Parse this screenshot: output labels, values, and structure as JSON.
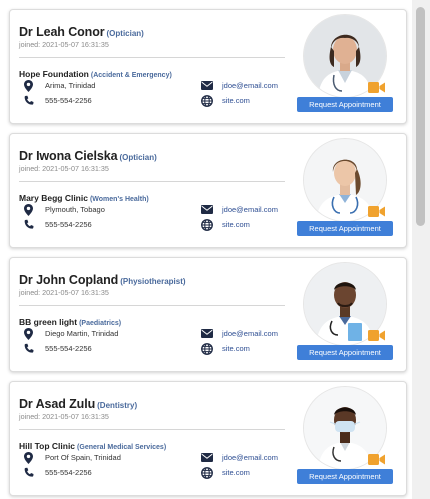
{
  "colors": {
    "accent": "#3f7fd8",
    "specialty_text": "#4a6a9c",
    "link": "#2f4f93",
    "video_icon": "#f0a22e"
  },
  "icons": {
    "location": "map-marker-icon",
    "phone": "phone-icon",
    "email": "envelope-icon",
    "website": "globe-icon",
    "video": "video-camera-icon"
  },
  "doctors": [
    {
      "name": "Dr Leah Conor",
      "specialty": "(Optician)",
      "joined": "joined: 2021-05-07 16:31:35",
      "facility": "Hope Foundation",
      "facility_type": "(Accident & Emergency)",
      "location": "Arima, Trinidad",
      "phone": "555-554-2256",
      "email": "jdoe@email.com",
      "website": "site.com",
      "button": "Request Appointment"
    },
    {
      "name": "Dr Iwona Cielska",
      "specialty": "(Optician)",
      "joined": "joined: 2021-05-07 16:31:35",
      "facility": "Mary Begg Clinic",
      "facility_type": "(Women's Health)",
      "location": "Plymouth, Tobago",
      "phone": "555-554-2256",
      "email": "jdoe@email.com",
      "website": "site.com",
      "button": "Request Appointment"
    },
    {
      "name": "Dr John Copland",
      "specialty": "(Physiotherapist)",
      "joined": "joined: 2021-05-07 16:31:35",
      "facility": "BB green light",
      "facility_type": "(Paediatrics)",
      "location": "Diego Martin, Trinidad",
      "phone": "555-554-2256",
      "email": "jdoe@email.com",
      "website": "site.com",
      "button": "Request Appointment"
    },
    {
      "name": "Dr Asad Zulu",
      "specialty": "(Dentistry)",
      "joined": "joined: 2021-05-07 16:31:35",
      "facility": "Hill Top Clinic",
      "facility_type": "(General Medical Services)",
      "location": "Port Of Spain, Trinidad",
      "phone": "555-554-2256",
      "email": "jdoe@email.com",
      "website": "site.com",
      "button": "Request Appointment"
    }
  ]
}
